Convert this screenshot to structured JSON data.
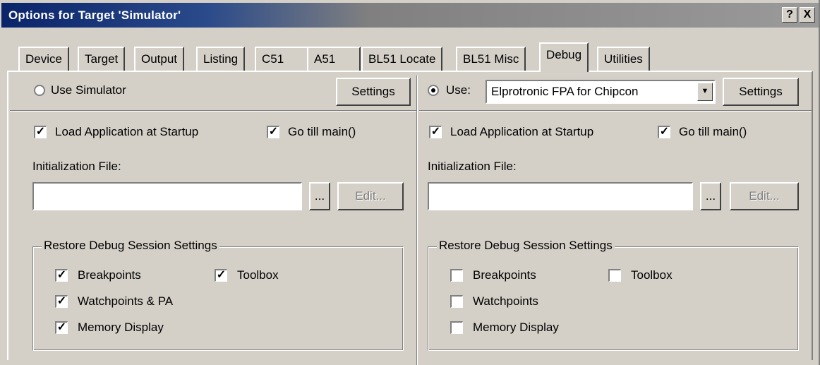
{
  "window": {
    "title": "Options for Target 'Simulator'",
    "help_label": "?",
    "close_label": "X"
  },
  "tabs": [
    "Device",
    "Target",
    "Output",
    "Listing",
    "C51",
    "A51",
    "BL51 Locate",
    "BL51 Misc",
    "Debug",
    "Utilities"
  ],
  "active_tab": "Debug",
  "left": {
    "use_simulator_label": "Use Simulator",
    "use_simulator_checked": false,
    "settings_label": "Settings",
    "load_app_label": "Load Application at Startup",
    "load_app_checked": true,
    "go_till_main_label": "Go  till main()",
    "go_till_main_checked": true,
    "init_file_label": "Initialization File:",
    "init_file_value": "",
    "browse_label": "...",
    "edit_label": "Edit...",
    "restore_group_title": "Restore Debug Session Settings",
    "restore": {
      "breakpoints_label": "Breakpoints",
      "breakpoints_checked": true,
      "toolbox_label": "Toolbox",
      "toolbox_checked": true,
      "watchpoints_label": "Watchpoints & PA",
      "watchpoints_checked": true,
      "memory_label": "Memory Display",
      "memory_checked": true
    }
  },
  "right": {
    "use_label": "Use:",
    "use_checked": true,
    "driver_value": "Elprotronic FPA for Chipcon",
    "settings_label": "Settings",
    "load_app_label": "Load Application at Startup",
    "load_app_checked": true,
    "go_till_main_label": "Go  till main()",
    "go_till_main_checked": true,
    "init_file_label": "Initialization File:",
    "init_file_value": "",
    "browse_label": "...",
    "edit_label": "Edit...",
    "restore_group_title": "Restore Debug Session Settings",
    "restore": {
      "breakpoints_label": "Breakpoints",
      "breakpoints_checked": false,
      "toolbox_label": "Toolbox",
      "toolbox_checked": false,
      "watchpoints_label": "Watchpoints",
      "watchpoints_checked": false,
      "memory_label": "Memory Display",
      "memory_checked": false
    }
  },
  "colors": {
    "title_start": "#0a246a",
    "title_end": "#9a9a9a",
    "face": "#d4d0c8"
  }
}
